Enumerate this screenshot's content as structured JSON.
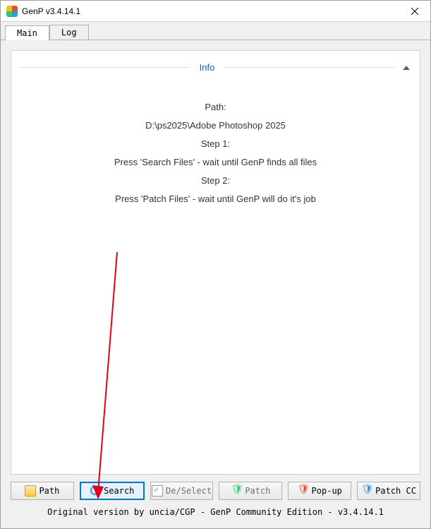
{
  "window": {
    "title": "GenP v3.4.14.1"
  },
  "tabs": {
    "main": "Main",
    "log": "Log"
  },
  "info": {
    "header": "Info",
    "path_label": "Path:",
    "path_value": "D:\\ps2025\\Adobe Photoshop 2025",
    "step1_label": "Step 1:",
    "step1_text": "Press 'Search Files' - wait until GenP finds all files",
    "step2_label": "Step 2:",
    "step2_text": "Press 'Patch Files' - wait until GenP will do it's job"
  },
  "buttons": {
    "path": "Path",
    "search": "Search",
    "deselect": "De/Select",
    "patch": "Patch",
    "popup": "Pop-up",
    "patchcc": "Patch CC"
  },
  "footer": "Original version by uncia/CGP - GenP Community Edition - v3.4.14.1"
}
